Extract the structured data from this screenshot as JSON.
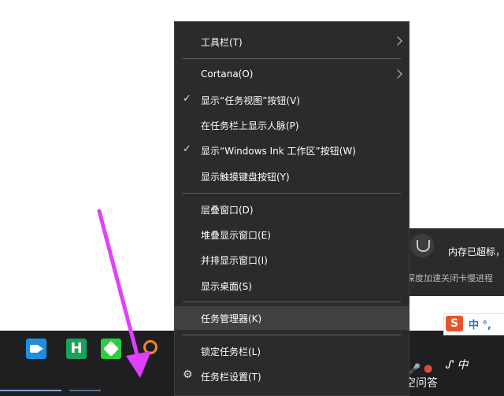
{
  "context_menu": {
    "items": [
      {
        "label": "工具栏(T)",
        "submenu": true
      },
      {
        "label": "Cortana(O)",
        "submenu": true
      },
      {
        "label": "显示“任务视图”按钮(V)",
        "checked": true
      },
      {
        "label": "在任务栏上显示人脉(P)"
      },
      {
        "label": "显示“Windows Ink 工作区”按钮(W)",
        "checked": true
      },
      {
        "label": "显示触摸键盘按钮(Y)"
      },
      {
        "label": "层叠窗口(D)"
      },
      {
        "label": "堆叠显示窗口(E)"
      },
      {
        "label": "并排显示窗口(I)"
      },
      {
        "label": "显示桌面(S)"
      },
      {
        "label": "任务管理器(K)",
        "highlighted": true
      },
      {
        "label": "锁定任务栏(L)"
      },
      {
        "label": "任务栏设置(T)",
        "icon": "gear-icon"
      }
    ]
  },
  "notification": {
    "title": "内存已超标，",
    "subtitle": "深度加速关闭卡慢进程",
    "icon": "shield-icon"
  },
  "ime": {
    "logo": "S",
    "text": "中 °,"
  },
  "taskbar": {
    "apps": [
      "video-camera-icon",
      "h-app-icon",
      "green-app-icon",
      "search-icon"
    ],
    "tray_text": "ᔑ 中"
  },
  "watermark": "悟空问答",
  "colors": {
    "menu_bg": "#2b2b2b",
    "highlight": "#414141",
    "arrow": "#e040fb",
    "taskbar": "#1f1f22"
  }
}
